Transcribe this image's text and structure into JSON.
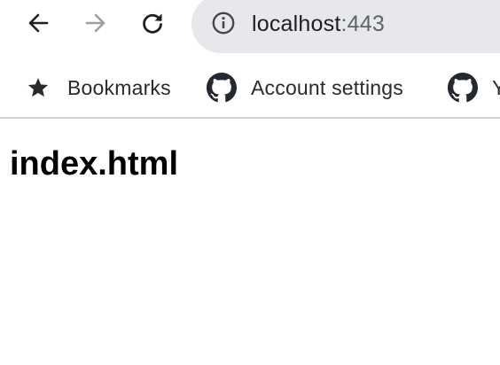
{
  "toolbar": {
    "back_icon": "back-arrow-icon",
    "forward_icon": "forward-arrow-icon",
    "reload_icon": "reload-icon",
    "address_bar": {
      "site_info_icon": "info-icon",
      "host": "localhost",
      "port": ":443"
    }
  },
  "bookmarks_bar": {
    "items": [
      {
        "label": "Bookmarks",
        "icon": "star-icon"
      },
      {
        "label": "Account settings",
        "icon": "github-icon"
      },
      {
        "label": "Y",
        "icon": "github-icon"
      }
    ]
  },
  "page": {
    "heading": "index.html"
  },
  "colors": {
    "omnibox_background": "#e7e8eb",
    "port_text": "#606368",
    "disabled_icon": "#9aa0a6",
    "separator": "#d0d1d3"
  }
}
